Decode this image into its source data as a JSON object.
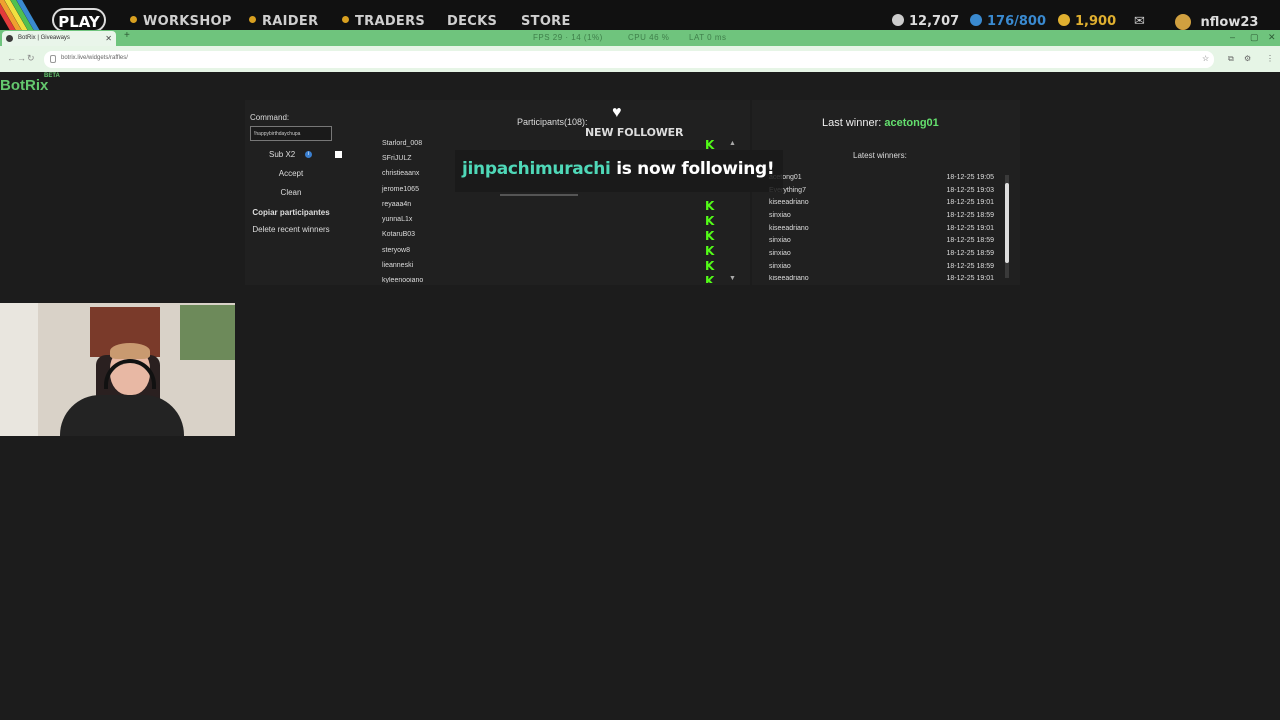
{
  "game_bar": {
    "play": "PLAY",
    "nav": [
      "WORKSHOP",
      "RAIDER",
      "TRADERS",
      "DECKS",
      "STORE"
    ],
    "stat_currency": "12,707",
    "stat_capacity": "176/800",
    "stat_gold": "1,900",
    "username": "nflow23"
  },
  "browser": {
    "tab_title": "BotRix | Giveaways",
    "new_tab": "+",
    "perf_fps": "FPS  29 · 14 (1%)",
    "perf_cpu": "CPU  46 %",
    "perf_lat": "LAT  0 ms",
    "url": "botrix.live/widgets/raffles/"
  },
  "app": {
    "logo": "BotRix",
    "beta": "BETA"
  },
  "controls": {
    "command_label": "Command:",
    "command_value": "!happybirthdaychupa",
    "sub_label": "Sub X2",
    "accept": "Accept",
    "clean": "Clean",
    "copy_participants": "Copiar participantes",
    "delete_recent": "Delete recent winners"
  },
  "participants": {
    "title": "Participants(108):",
    "names": [
      "Starlord_008",
      "SFriJULZ",
      "christieaanx",
      "jerome1065",
      "reyaaa4n",
      "yunnaL1x",
      "KotaruB03",
      "steryow8",
      "lieanneski",
      "kyleenooiano"
    ]
  },
  "winners": {
    "last_label": "Last winner: ",
    "last_name": "acetong01",
    "latest_title": "Latest winners:",
    "rows": [
      {
        "name": "acetong01",
        "date": "18-12-25 19:05"
      },
      {
        "name": "Everything7",
        "date": "18-12-25 19:03"
      },
      {
        "name": "kiseeadriano",
        "date": "18-12-25 19:01"
      },
      {
        "name": "sinxiao",
        "date": "18-12-25 18:59"
      },
      {
        "name": "kiseeadriano",
        "date": "18-12-25 19:01"
      },
      {
        "name": "sinxiao",
        "date": "18-12-25 18:59"
      },
      {
        "name": "sinxiao",
        "date": "18-12-25 18:59"
      },
      {
        "name": "sinxiao",
        "date": "18-12-25 18:59"
      },
      {
        "name": "kiseeadriano",
        "date": "18-12-25 19:01"
      }
    ]
  },
  "alert": {
    "header": "NEW FOLLOWER",
    "user": "jinpachimurachi",
    "text": " is now following!"
  },
  "colors": {
    "accent": "#64c86e",
    "kick_green": "#53fc18",
    "alert_user": "#4fd8b8"
  }
}
